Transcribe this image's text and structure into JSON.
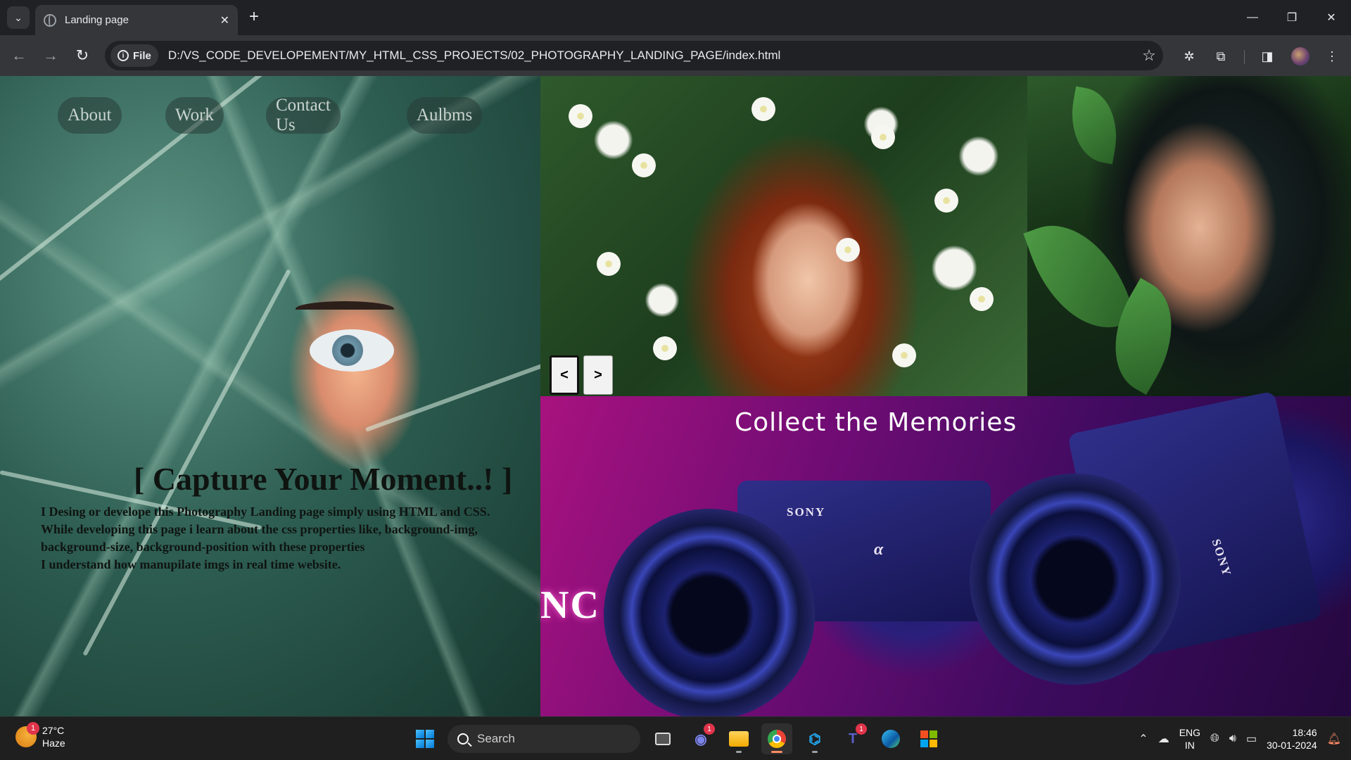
{
  "browser": {
    "tab_title": "Landing page",
    "tab_close": "✕",
    "new_tab": "+",
    "window_controls": [
      "—",
      "❐",
      "✕"
    ],
    "nav_back": "←",
    "nav_forward": "→",
    "nav_reload": "↻",
    "site_chip_label": "File",
    "url": "D:/VS_CODE_DEVELOPEMENT/MY_HTML_CSS_PROJECTS/02_PHOTOGRAPHY_LANDING_PAGE/index.html",
    "star_icon": "☆",
    "tab_search_icon": "⌄"
  },
  "page": {
    "nav": {
      "about": "About",
      "work": "Work",
      "contact": "Contact Us",
      "albums": "Aulbms"
    },
    "hero_title": "[ Capture Your Moment..! ]",
    "hero_lines": [
      "I Desing or develope this Photography Landing page simply using HTML and CSS.",
      "While developing this page i learn about the css properties like, background-img,",
      "background-size, background-position with these properties",
      "I understand how manupilate imgs in real time website."
    ],
    "slider_prev": "<",
    "slider_next": ">",
    "collect_title": "Collect the Memories",
    "sony_1": "SONY",
    "sony_2": "SONY",
    "alpha_mark": "α",
    "neon_fragment": "NC"
  },
  "taskbar": {
    "weather_temp": "27°C",
    "weather_desc": "Haze",
    "weather_badge": "1",
    "search_label": "Search",
    "teams_badge": "1",
    "teams2_badge": "1",
    "lang_top": "ENG",
    "lang_bottom": "IN",
    "time": "18:46",
    "date": "30-01-2024"
  },
  "colors": {
    "chrome_dark": "#202124",
    "chrome_toolbar": "#35363a",
    "taskbar": "#1f1f1f",
    "camera_magenta": "#a8127f",
    "camera_purple": "#3c0b5e"
  }
}
